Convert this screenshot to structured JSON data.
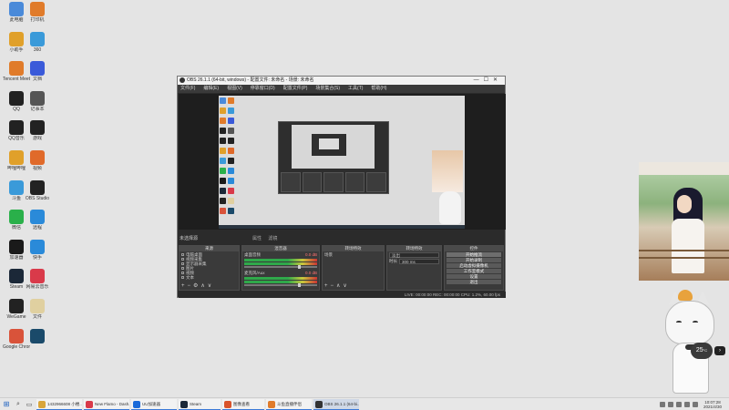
{
  "obs": {
    "title": "OBS 26.1.1 (64-bit, windows) - 配置文件: 未命名 - 场景: 未命名",
    "menu": [
      "文件(F)",
      "编辑(E)",
      "视图(V)",
      "停靠窗口(D)",
      "配置文件(P)",
      "场景集合(S)",
      "工具(T)",
      "帮助(H)"
    ],
    "scene_label": "未选择源",
    "mixer_controls": [
      "属性",
      "滤镜"
    ],
    "docks": {
      "sources": {
        "title": "来源",
        "items": [
          "电脑桌面",
          "视频采集",
          "显示器采集",
          "图片",
          "视频",
          "文本"
        ]
      },
      "mixer": {
        "title": "混音器",
        "channels": [
          {
            "name": "桌面音频",
            "db": "0.0 dB"
          },
          {
            "name": "麦克风/Aux",
            "db": "0.0 dB"
          }
        ]
      },
      "transitions": {
        "title": "转场特效",
        "items": [
          "场景"
        ]
      },
      "scene_trans": {
        "title": "转场特效",
        "select": "淡出",
        "duration_label": "时长",
        "duration_value": "300 ms"
      },
      "controls": {
        "title": "控件",
        "buttons": [
          "开始推流",
          "开始录制",
          "启动虚拟摄像机",
          "工作室模式",
          "设置",
          "退出"
        ]
      }
    },
    "status": "LIVE: 00:00:00   REC: 00:00:00   CPU: 1.2%, 60.00 fps"
  },
  "overlay": {
    "temp": "25",
    "temp_unit": "°C",
    "arrow": "›"
  },
  "taskbar": {
    "tasks": [
      {
        "label": "1432966608 小楼...",
        "color": "#d9a53a"
      },
      {
        "label": "New Flamo - Dash...",
        "color": "#d93a4a"
      },
      {
        "label": "UU加速器",
        "color": "#1a6ad9"
      },
      {
        "label": "Steam",
        "color": "#1b2838"
      },
      {
        "label": "图像查看",
        "color": "#d9532a"
      },
      {
        "label": "斗鱼直播伴侣",
        "color": "#e07b2a"
      },
      {
        "label": "OBS 26.1.1 (64-bi...",
        "color": "#333333",
        "active": true
      }
    ],
    "clock_time": "10:07:28",
    "clock_date": "2021/4/30"
  },
  "desktop_icons": [
    {
      "label": "此电脑",
      "color": "#4a8ad9"
    },
    {
      "label": "打印机",
      "color": "#e07b2a"
    },
    {
      "label": "小助手",
      "color": "#e0a02a"
    },
    {
      "label": "360",
      "color": "#3a9ad9"
    },
    {
      "label": "Tencent Meeting",
      "color": "#e07b2a"
    },
    {
      "label": "文档",
      "color": "#3a5ad9"
    },
    {
      "label": "QQ",
      "color": "#222222"
    },
    {
      "label": "记事本",
      "color": "#555555"
    },
    {
      "label": "QQ音乐",
      "color": "#222222"
    },
    {
      "label": "游戏",
      "color": "#222222"
    },
    {
      "label": "哔哩哔哩",
      "color": "#e0a02a"
    },
    {
      "label": "视频",
      "color": "#e06a2a"
    },
    {
      "label": "斗鱼",
      "color": "#3a9ad9"
    },
    {
      "label": "OBS Studio",
      "color": "#222222"
    },
    {
      "label": "微信",
      "color": "#2ab04a"
    },
    {
      "label": "远程",
      "color": "#2a8ad9"
    },
    {
      "label": "加速器",
      "color": "#1a1a1a"
    },
    {
      "label": "快手",
      "color": "#2a8ad9"
    },
    {
      "label": "Steam",
      "color": "#1b2838"
    },
    {
      "label": "网易云音乐",
      "color": "#d93a4a"
    },
    {
      "label": "WeGame",
      "color": "#222222"
    },
    {
      "label": "文件",
      "color": "#e0d0a0"
    },
    {
      "label": "Google Chrome",
      "color": "#d9533a"
    },
    {
      "label": "",
      "color": "#1a4a6a"
    }
  ]
}
